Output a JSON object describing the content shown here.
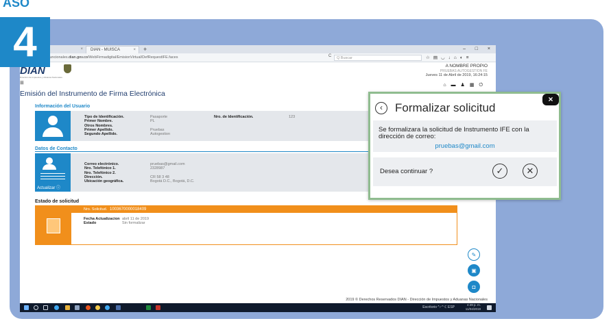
{
  "step": {
    "label": "ASO",
    "number": "4"
  },
  "colors": {
    "accent": "#1e88c8",
    "frame": "#8ea9d8",
    "orange": "#f18f1b",
    "modal_border": "#8fbc8f"
  },
  "browser": {
    "tabs": [
      {
        "label": "",
        "close": "×"
      },
      {
        "label": "DIAN - MUISCA",
        "close": "×"
      }
    ],
    "new_tab": "+",
    "window_controls": [
      "–",
      "□",
      "×"
    ],
    "url_prefix": "cefuncionales.",
    "url_domain": "dian.gov.co",
    "url_path": "/WebFirmadigital/EmisionVirtual/DefRequestIFE.faces",
    "reload": "C",
    "search_placeholder": "Q Buscar",
    "toolbar_icons": [
      "star-icon",
      "reading-list-icon",
      "pocket-icon",
      "download-icon",
      "home-icon",
      "sync-icon",
      "menu-icon"
    ]
  },
  "header": {
    "logo": "DIAN",
    "logo_sub": "Dirección de Impuestos y Aduanas Nacionales",
    "nombre_propio": "A NOMBRE PROPIO",
    "autogestion": "PRUEBAS AUTOGESTION FE",
    "fecha": "Jueves 11 de Abril de 2019, 16:24:15",
    "icons": [
      "home-icon",
      "folder-icon",
      "person-icon",
      "calendar-icon",
      "power-icon"
    ]
  },
  "page_title": "Emisión del Instrumento de Firma Electrónica",
  "usuario": {
    "title": "Información del Usuario",
    "labels": [
      "Tipo de Identificación.",
      "Primer Nombre.",
      "Otros Nombres.",
      "Primer Apellido.",
      "Segundo Apellido."
    ],
    "values": [
      "Pasaporte",
      "PL",
      "",
      "Pruebas",
      "Autogestion"
    ],
    "id_label": "Nro. de Identificación.",
    "id_value": "123"
  },
  "contacto": {
    "title": "Datos de Contacto",
    "labels": [
      "Correo electrónico.",
      "Nro. Telefónico 1.",
      "Nro. Telefónico 2.",
      "Dirección.",
      "Ubicación geográfica."
    ],
    "values": [
      "pruebas@gmail.com",
      "2328987",
      "",
      "CR 58 3 48",
      "Bogotá D.C., Bogotá, D.C."
    ],
    "actualizar": "Actualizar"
  },
  "estado": {
    "title": "Estado de solicitud",
    "nro_label": "Nro. Solicitud.",
    "nro_value": "1003670000018409",
    "labels": [
      "Fecha Actualizacion",
      "Estado"
    ],
    "values": [
      "abril 11 de 2019",
      "Sin formalizar"
    ]
  },
  "footer": "2019 © Derechos Reservados DIAN - Dirección de Impuestos y Aduanas Nacionales",
  "taskbar": {
    "tray": "Escritorio  ^  ∕  ^  ℂ  ESP",
    "time": "4:49 p. m.",
    "date": "11/04/2019"
  },
  "modal": {
    "title": "Formalizar solicitud",
    "message": "Se formalizara la solicitud de Instrumento IFE con la dirección de correo:",
    "email": "pruebas@gmail.com",
    "question": "Desea continuar ?",
    "confirm": "✓",
    "cancel": "✕",
    "close": "×",
    "back": "‹"
  }
}
